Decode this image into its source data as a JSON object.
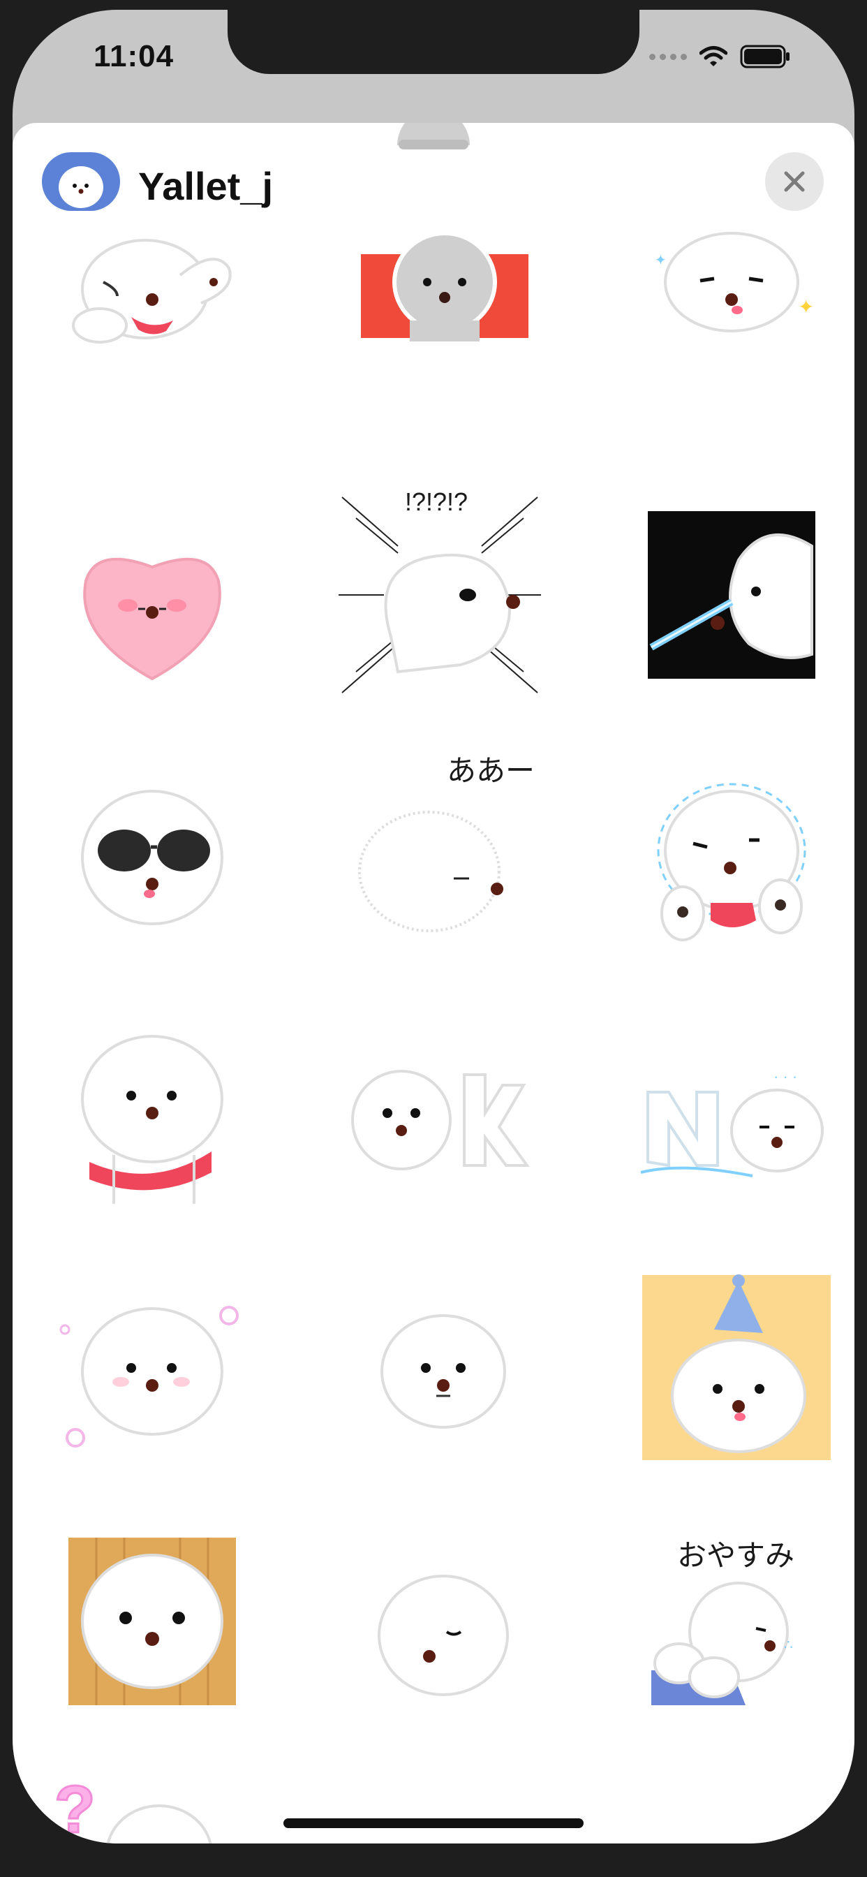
{
  "status_bar": {
    "time": "11:04",
    "icons": [
      "cellular-signal-icon",
      "wifi-icon",
      "battery-icon"
    ]
  },
  "sheet": {
    "pack_name": "Yallet_j",
    "avatar_icon": "bichon-dog-avatar",
    "close_icon": "close-icon",
    "accent_color": "#5b82d6"
  },
  "stickers": [
    {
      "name": "sticker-waving-paw"
    },
    {
      "name": "sticker-angry-red-background"
    },
    {
      "name": "sticker-smug-sparkles"
    },
    {
      "name": "sticker-pink-heart-face"
    },
    {
      "name": "sticker-shocked-manga",
      "caption": "!?!?!?"
    },
    {
      "name": "sticker-laser-eyes"
    },
    {
      "name": "sticker-sunglasses"
    },
    {
      "name": "sticker-sigh",
      "caption": "ああー"
    },
    {
      "name": "sticker-paws-up-worried"
    },
    {
      "name": "sticker-red-scarf-teary"
    },
    {
      "name": "sticker-ok-letters"
    },
    {
      "name": "sticker-no-letters-melting"
    },
    {
      "name": "sticker-bubbles-worried"
    },
    {
      "name": "sticker-plain-face"
    },
    {
      "name": "sticker-party-hat"
    },
    {
      "name": "sticker-wood-frame-face"
    },
    {
      "name": "sticker-sleepy-face"
    },
    {
      "name": "sticker-good-night",
      "caption": "おやすみ"
    },
    {
      "name": "sticker-question-sitting"
    }
  ]
}
